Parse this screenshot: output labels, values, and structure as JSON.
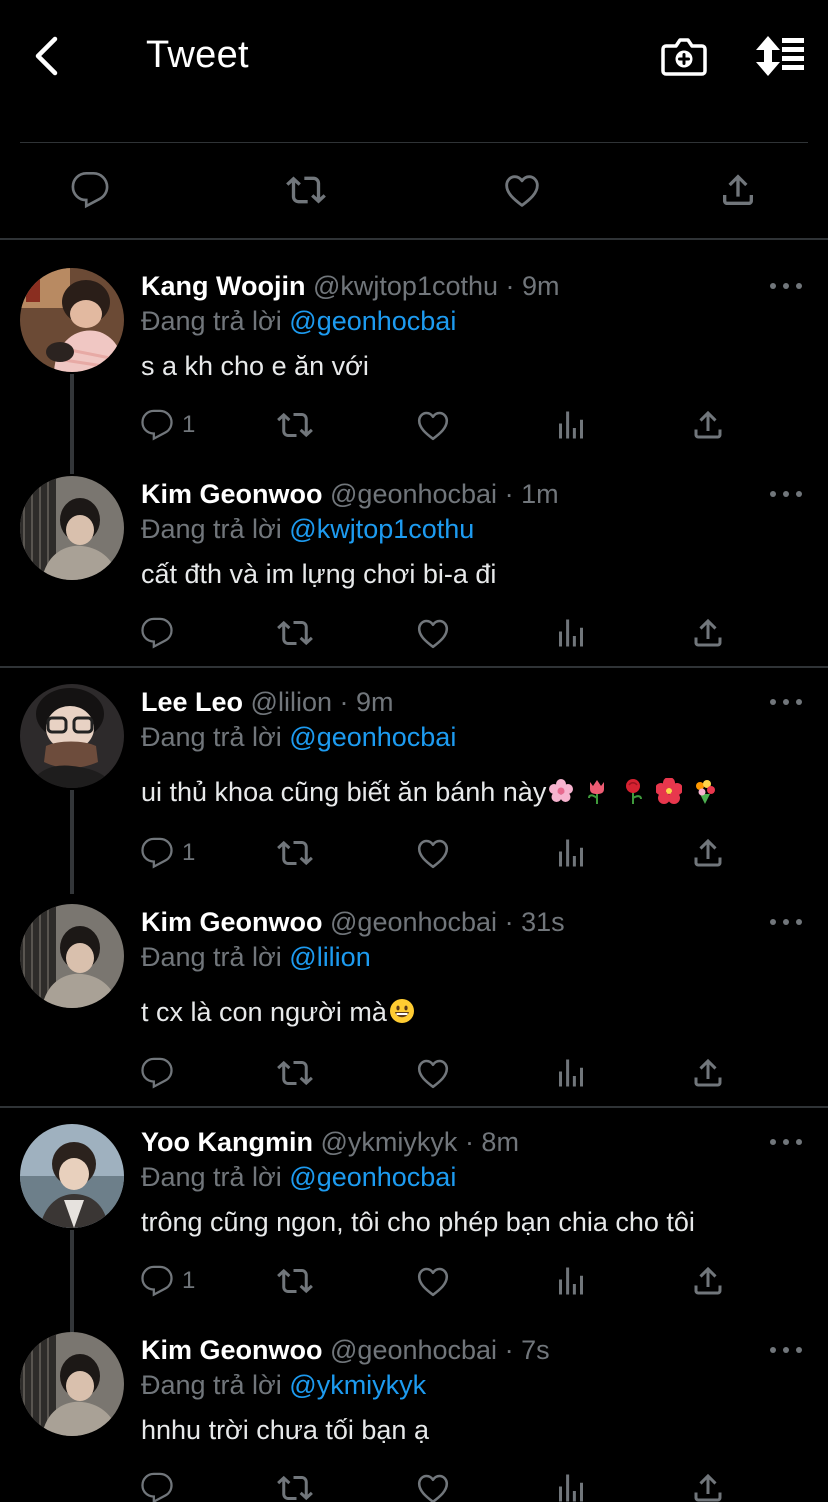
{
  "header": {
    "title": "Tweet"
  },
  "replies": [
    {
      "name": "Kang Woojin",
      "handle": "@kwjtop1cothu",
      "time": "· 9m",
      "replying_label": "Đang trả lời",
      "replying_to": "@geonhocbai",
      "text": "s a kh cho e ăn với",
      "reply_count": "1"
    },
    {
      "name": "Kim Geonwoo",
      "handle": "@geonhocbai",
      "time": "· 1m",
      "replying_label": "Đang trả lời",
      "replying_to": "@kwjtop1cothu",
      "text": "cất đth và im lựng chơi bi-a đi",
      "reply_count": ""
    },
    {
      "name": "Lee Leo",
      "handle": "@lilion",
      "time": "· 9m",
      "replying_label": "Đang trả lời",
      "replying_to": "@geonhocbai",
      "text": "ui thủ khoa cũng biết ăn bánh này",
      "reply_count": "1"
    },
    {
      "name": "Kim Geonwoo",
      "handle": "@geonhocbai",
      "time": "· 31s",
      "replying_label": "Đang trả lời",
      "replying_to": "@lilion",
      "text": "t cx là con người mà",
      "reply_count": ""
    },
    {
      "name": "Yoo Kangmin",
      "handle": "@ykmiykyk",
      "time": "· 8m",
      "replying_label": "Đang trả lời",
      "replying_to": "@geonhocbai",
      "text": "trông cũng ngon, tôi cho phép bạn chia cho tôi",
      "reply_count": "1"
    },
    {
      "name": "Kim Geonwoo",
      "handle": "@geonhocbai",
      "time": "· 7s",
      "replying_label": "Đang trả lời",
      "replying_to": "@ykmiykyk",
      "text": "hnhu trời chưa tối bạn ạ",
      "reply_count": ""
    }
  ],
  "colors": {
    "background": "#000000",
    "primary_text": "#e7e9ea",
    "secondary_text": "#71767b",
    "accent": "#1d9bf0",
    "divider": "#2f3336"
  },
  "icons": {
    "back": "chevron-left-icon",
    "camera": "camera-plus-icon",
    "sort": "sort-icon",
    "reply": "reply-icon",
    "retweet": "retweet-icon",
    "like": "heart-icon",
    "analytics": "bar-chart-icon",
    "share": "share-icon",
    "more": "more-icon"
  }
}
